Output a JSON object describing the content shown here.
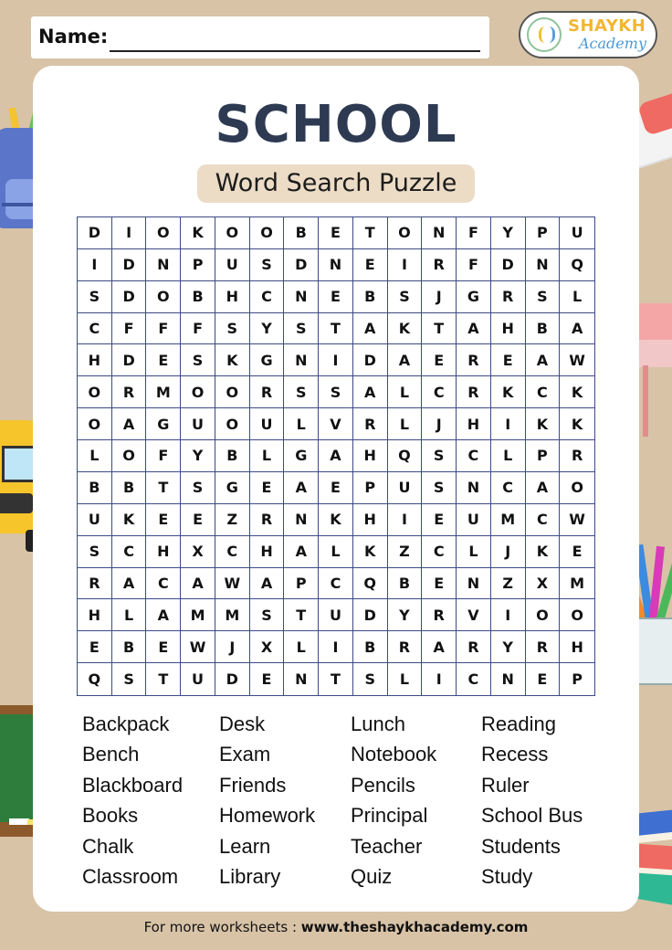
{
  "header": {
    "name_label": "Name:",
    "logo_line1": "SHAYKH",
    "logo_line2": "Academy"
  },
  "title": "SCHOOL",
  "subtitle": "Word Search Puzzle",
  "grid": [
    "DIOKOOBETONFYPU",
    "IDNPUSDNEIRFDNQ",
    "SDOBHCNEBSJGRSL",
    "CFFFSYSTAKTAHBA",
    "HDESKGNIDAEREAW",
    "ORMOORSSALCRKCK",
    "OAGUOULVRLJHIKK",
    "LOFYBLGAHQSCLPR",
    "BBTSGEAEPUSNCAO",
    "UKEEZRNKHIEUMCW",
    "SCHXCHALKZCLJKE",
    "RACAWAPCQBENZXM",
    "HLAMMSTUDYRVIOO",
    "EBEWJXLIBRARYRH",
    "QSTUDENTSLICNEP"
  ],
  "words": [
    [
      "Backpack",
      "Bench",
      "Blackboard",
      "Books",
      "Chalk",
      "Classroom"
    ],
    [
      "Desk",
      "Exam",
      "Friends",
      "Homework",
      "Learn",
      "Library"
    ],
    [
      "Lunch",
      "Notebook",
      "Pencils",
      "Principal",
      "Teacher",
      "Quiz"
    ],
    [
      "Reading",
      "Recess",
      "Ruler",
      "School Bus",
      "Students",
      "Study"
    ]
  ],
  "footer": {
    "prefix": "For more worksheets : ",
    "url": "www.theshaykhacademy.com"
  },
  "colors": {
    "background": "#d8c3a7",
    "title": "#2d3a52",
    "grid_lines": "#3c4a86",
    "subtitle_box": "#ecdcc6",
    "logo_gold": "#f2b632",
    "logo_blue": "#4a9bd6"
  }
}
